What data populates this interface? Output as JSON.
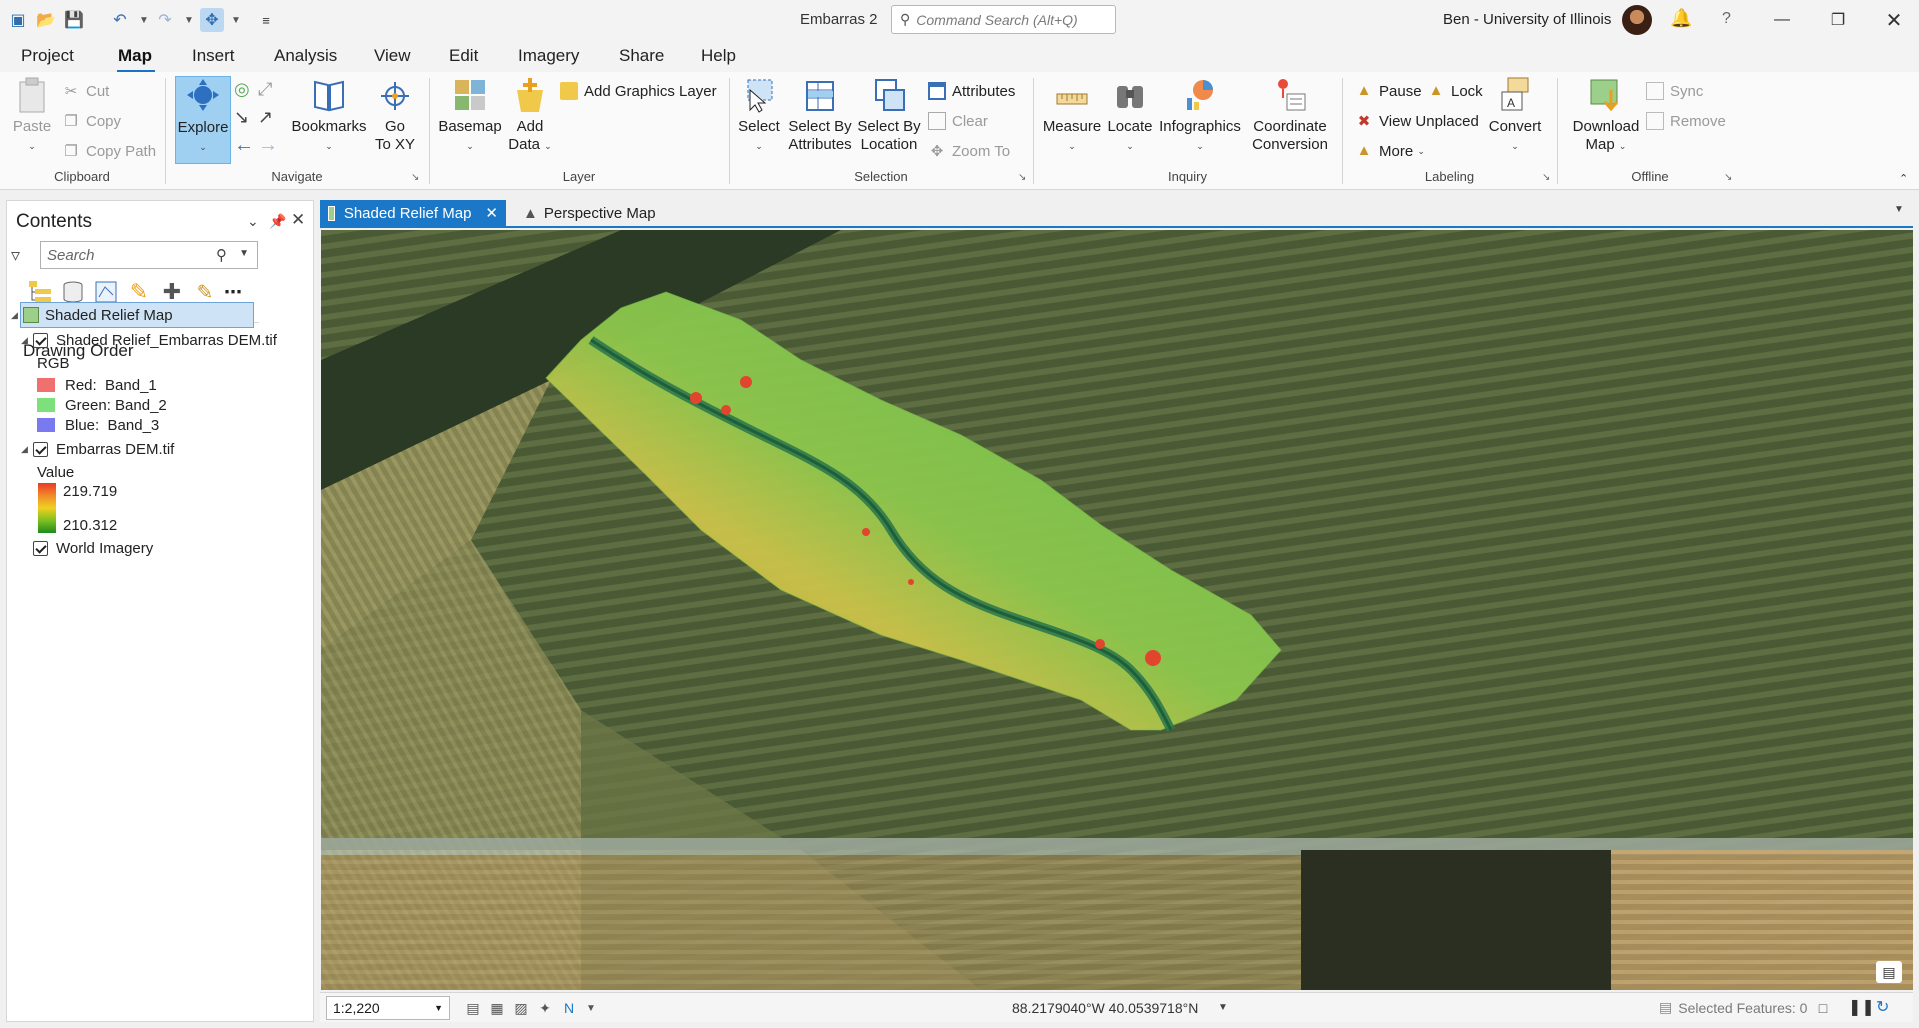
{
  "title_bar": {
    "document_title": "Embarras 2",
    "command_search_placeholder": "Command Search (Alt+Q)",
    "user": "Ben - University of Illinois",
    "help": "?"
  },
  "menu_tabs": [
    "Project",
    "Map",
    "Insert",
    "Analysis",
    "View",
    "Edit",
    "Imagery",
    "Share",
    "Help"
  ],
  "ribbon": {
    "clipboard": {
      "label": "Clipboard",
      "paste": "Paste",
      "cut": "Cut",
      "copy": "Copy",
      "copy_path": "Copy Path"
    },
    "navigate": {
      "label": "Navigate",
      "explore": "Explore",
      "bookmarks": "Bookmarks",
      "go_to_xy_1": "Go",
      "go_to_xy_2": "To XY"
    },
    "layer": {
      "label": "Layer",
      "basemap": "Basemap",
      "add_data_1": "Add",
      "add_data_2": "Data",
      "add_graphics_layer": "Add Graphics Layer"
    },
    "selection": {
      "label": "Selection",
      "select": "Select",
      "select_by_attributes_1": "Select By",
      "select_by_attributes_2": "Attributes",
      "select_by_location_1": "Select By",
      "select_by_location_2": "Location",
      "attributes": "Attributes",
      "clear": "Clear",
      "zoom_to": "Zoom To"
    },
    "inquiry": {
      "label": "Inquiry",
      "measure": "Measure",
      "locate": "Locate",
      "infographics": "Infographics",
      "coord_conv_1": "Coordinate",
      "coord_conv_2": "Conversion"
    },
    "labeling": {
      "label": "Labeling",
      "pause": "Pause",
      "lock": "Lock",
      "view_unplaced": "View Unplaced",
      "more": "More",
      "convert": "Convert"
    },
    "offline": {
      "label": "Offline",
      "download_map_1": "Download",
      "download_map_2": "Map",
      "sync": "Sync",
      "remove": "Remove"
    }
  },
  "contents": {
    "title": "Contents",
    "search_placeholder": "Search",
    "drawing_order": "Drawing Order",
    "map_name": "Shaded Relief Map",
    "layer1": {
      "name": "Shaded Relief_Embarras DEM.tif",
      "rgb_label": "RGB",
      "bands": [
        {
          "label": "Red:",
          "value": "Band_1",
          "color": "#f07070"
        },
        {
          "label": "Green:",
          "value": "Band_2",
          "color": "#7ee07a"
        },
        {
          "label": "Blue:",
          "value": "Band_3",
          "color": "#7a7af0"
        }
      ]
    },
    "layer2": {
      "name": "Embarras DEM.tif",
      "value_label": "Value",
      "max": "219.719",
      "min": "210.312"
    },
    "layer3": {
      "name": "World Imagery"
    }
  },
  "map_tabs": {
    "active": "Shaded Relief Map",
    "second": "Perspective Map"
  },
  "status_bar": {
    "scale": "1:2,220",
    "coordinates": "88.2179040°W 40.0539718°N",
    "selected_features": "Selected Features: 0"
  },
  "colors": {
    "accent": "#1b78c8",
    "selected_row": "#cfe3f6",
    "dem_high": "#e8412a",
    "dem_low": "#2d8a2d"
  }
}
